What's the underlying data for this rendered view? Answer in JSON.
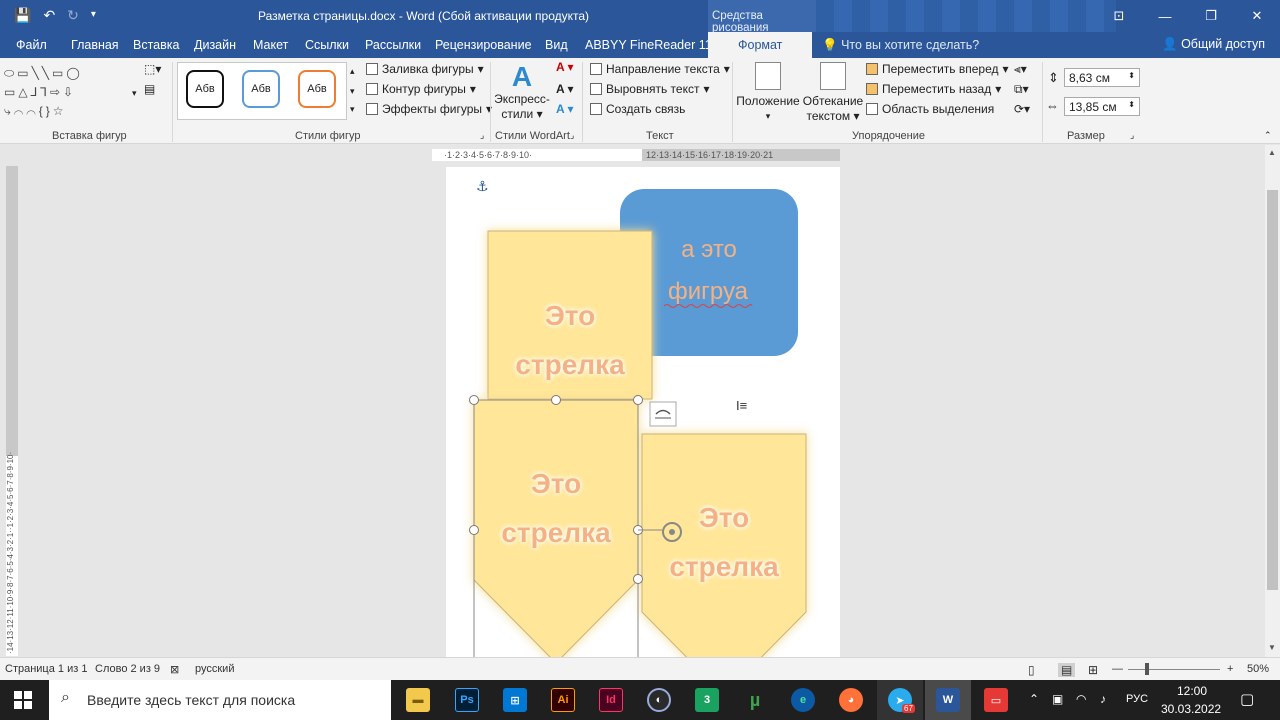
{
  "window": {
    "title": "Разметка страницы.docx - Word (Сбой активации продукта)",
    "context_group": "Средства рисования"
  },
  "tabs": [
    {
      "label": "Файл"
    },
    {
      "label": "Главная"
    },
    {
      "label": "Вставка"
    },
    {
      "label": "Дизайн"
    },
    {
      "label": "Макет"
    },
    {
      "label": "Ссылки"
    },
    {
      "label": "Рассылки"
    },
    {
      "label": "Рецензирование"
    },
    {
      "label": "Вид"
    },
    {
      "label": "ABBYY FineReader 11"
    },
    {
      "label": "Формат"
    }
  ],
  "tell_me": "Что вы хотите сделать?",
  "share": "Общий доступ",
  "ribbon": {
    "insert_shapes": {
      "label": "Вставка фигур"
    },
    "shape_styles": {
      "label": "Стили фигур",
      "swatch": "Абв",
      "fill": "Заливка фигуры",
      "outline": "Контур фигуры",
      "effects": "Эффекты фигуры"
    },
    "wordart": {
      "label": "Стили WordArt",
      "express": "Экспресс-",
      "styles": "стили",
      "letter": "A"
    },
    "text": {
      "label": "Текст",
      "direction": "Направление текста",
      "align": "Выровнять текст",
      "link": "Создать связь"
    },
    "arrange": {
      "label": "Упорядочение",
      "position": "Положение",
      "wrap1": "Обтекание",
      "wrap2": "текстом",
      "forward": "Переместить вперед",
      "backward": "Переместить назад",
      "selection": "Область выделения"
    },
    "size": {
      "label": "Размер",
      "height": "8,63 см",
      "width": "13,85 см"
    }
  },
  "ruler": {
    "h_left": "·1·2·3·4·5·6·7·8·9·10·",
    "h_right": "12·13·14·15·16·17·18·19·20·21",
    "v_text": "·14·13·12·11·10·9·8·7·6·5·4·3·2·1··1·2·3·4·5·6·7·8·9·10·"
  },
  "document": {
    "blue_shape": {
      "line1": "а это",
      "line2": "фигруа",
      "color": "#5b9bd5"
    },
    "arrow_text": {
      "line1": "Это",
      "line2": "стрелка"
    },
    "arrow_color": "#ffe699",
    "glow_color": "#ffff66"
  },
  "status": {
    "page": "Страница 1 из 1",
    "words": "Слово 2 из 9",
    "lang": "русский",
    "zoom": "50%"
  },
  "taskbar": {
    "search_placeholder": "Введите здесь текст для поиска",
    "lang": "РУС",
    "time": "12:00",
    "date": "30.03.2022",
    "telegram_badge": "67"
  }
}
